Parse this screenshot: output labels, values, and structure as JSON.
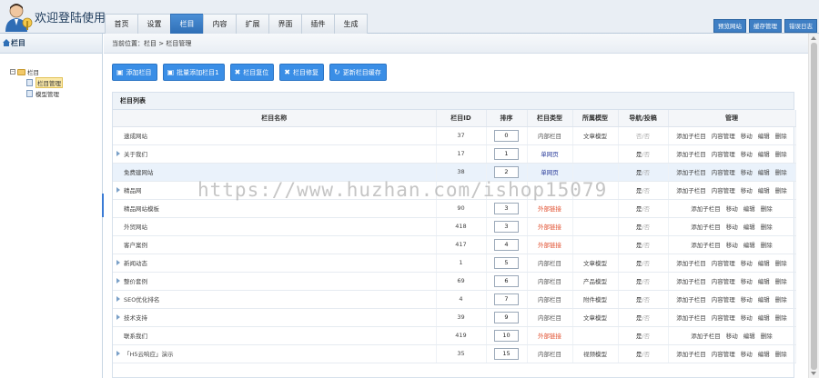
{
  "app": {
    "title": "欢迎登陆使用",
    "nav": [
      {
        "label": "首页",
        "active": false
      },
      {
        "label": "设置",
        "active": false
      },
      {
        "label": "栏目",
        "active": true
      },
      {
        "label": "内容",
        "active": false
      },
      {
        "label": "扩展",
        "active": false
      },
      {
        "label": "界面",
        "active": false
      },
      {
        "label": "插件",
        "active": false
      },
      {
        "label": "生成",
        "active": false
      }
    ],
    "top_right": [
      "预览网站",
      "缓存管理",
      "错误日志"
    ]
  },
  "sidebar": {
    "header": "栏目",
    "root": "栏目",
    "items": [
      {
        "label": "栏目管理",
        "selected": true
      },
      {
        "label": "模型管理",
        "selected": false
      }
    ]
  },
  "breadcrumb": "当前位置：栏目 > 栏目管理",
  "toolbar": {
    "add": "添加栏目",
    "batch_add": "批量添加栏目1",
    "reset": "栏目复位",
    "repair": "栏目修复",
    "update_cache": "更新栏目缓存"
  },
  "panel": {
    "title": "栏目列表",
    "columns": [
      "栏目名称",
      "栏目ID",
      "排序",
      "栏目类型",
      "所属模型",
      "导航/投稿",
      "管理"
    ],
    "nav_yes": "是",
    "nav_sep": "/",
    "nav_no": "否",
    "actions": {
      "add_child": "添加子栏目",
      "content": "内容管理",
      "move": "移动",
      "edit": "编辑",
      "delete": "删除"
    },
    "rows": [
      {
        "name": "速成网站",
        "id": "37",
        "sort": "0",
        "type": "内部栏目",
        "type_kind": "inner",
        "model": "文章模型",
        "nav": "否",
        "post": "否",
        "expandable": false,
        "content_mgmt": true,
        "highlight": false
      },
      {
        "name": "关于我们",
        "id": "17",
        "sort": "1",
        "type": "单网页",
        "type_kind": "single",
        "model": "",
        "nav": "是",
        "post": "否",
        "expandable": true,
        "content_mgmt": true,
        "highlight": false
      },
      {
        "name": "免费建网站",
        "id": "38",
        "sort": "2",
        "type": "单网页",
        "type_kind": "single",
        "model": "",
        "nav": "是",
        "post": "否",
        "expandable": false,
        "content_mgmt": true,
        "highlight": true
      },
      {
        "name": "精品网",
        "id": "",
        "sort": "",
        "type": "",
        "type_kind": "inner",
        "model": "",
        "nav": "是",
        "post": "否",
        "expandable": true,
        "content_mgmt": true,
        "highlight": false
      },
      {
        "name": "精品网站模板",
        "id": "90",
        "sort": "3",
        "type": "外部链接",
        "type_kind": "link",
        "model": "",
        "nav": "是",
        "post": "否",
        "expandable": false,
        "content_mgmt": false,
        "highlight": false
      },
      {
        "name": "外贸网站",
        "id": "418",
        "sort": "3",
        "type": "外部链接",
        "type_kind": "link",
        "model": "",
        "nav": "是",
        "post": "否",
        "expandable": false,
        "content_mgmt": false,
        "highlight": false
      },
      {
        "name": "客户案例",
        "id": "417",
        "sort": "4",
        "type": "外部链接",
        "type_kind": "link",
        "model": "",
        "nav": "是",
        "post": "否",
        "expandable": false,
        "content_mgmt": false,
        "highlight": false
      },
      {
        "name": "新闻动态",
        "id": "1",
        "sort": "5",
        "type": "内部栏目",
        "type_kind": "inner",
        "model": "文章模型",
        "nav": "是",
        "post": "否",
        "expandable": true,
        "content_mgmt": true,
        "highlight": false
      },
      {
        "name": "整价套例",
        "id": "69",
        "sort": "6",
        "type": "内部栏目",
        "type_kind": "inner",
        "model": "产品模型",
        "nav": "是",
        "post": "否",
        "expandable": true,
        "content_mgmt": true,
        "highlight": false
      },
      {
        "name": "SEO优化排名",
        "id": "4",
        "sort": "7",
        "type": "内部栏目",
        "type_kind": "inner",
        "model": "附件模型",
        "nav": "是",
        "post": "否",
        "expandable": true,
        "content_mgmt": true,
        "highlight": false
      },
      {
        "name": "技术支持",
        "id": "39",
        "sort": "9",
        "type": "内部栏目",
        "type_kind": "inner",
        "model": "文章模型",
        "nav": "是",
        "post": "否",
        "expandable": true,
        "content_mgmt": true,
        "highlight": false
      },
      {
        "name": "联系我们",
        "id": "419",
        "sort": "10",
        "type": "外部链接",
        "type_kind": "link",
        "model": "",
        "nav": "是",
        "post": "否",
        "expandable": false,
        "content_mgmt": false,
        "highlight": false
      },
      {
        "name": "「H5云响应」演示",
        "id": "35",
        "sort": "15",
        "type": "内部栏目",
        "type_kind": "inner",
        "model": "视频模型",
        "nav": "是",
        "post": "否",
        "expandable": true,
        "content_mgmt": true,
        "highlight": false
      }
    ]
  },
  "watermark": "https://www.huzhan.com/ishop15079"
}
